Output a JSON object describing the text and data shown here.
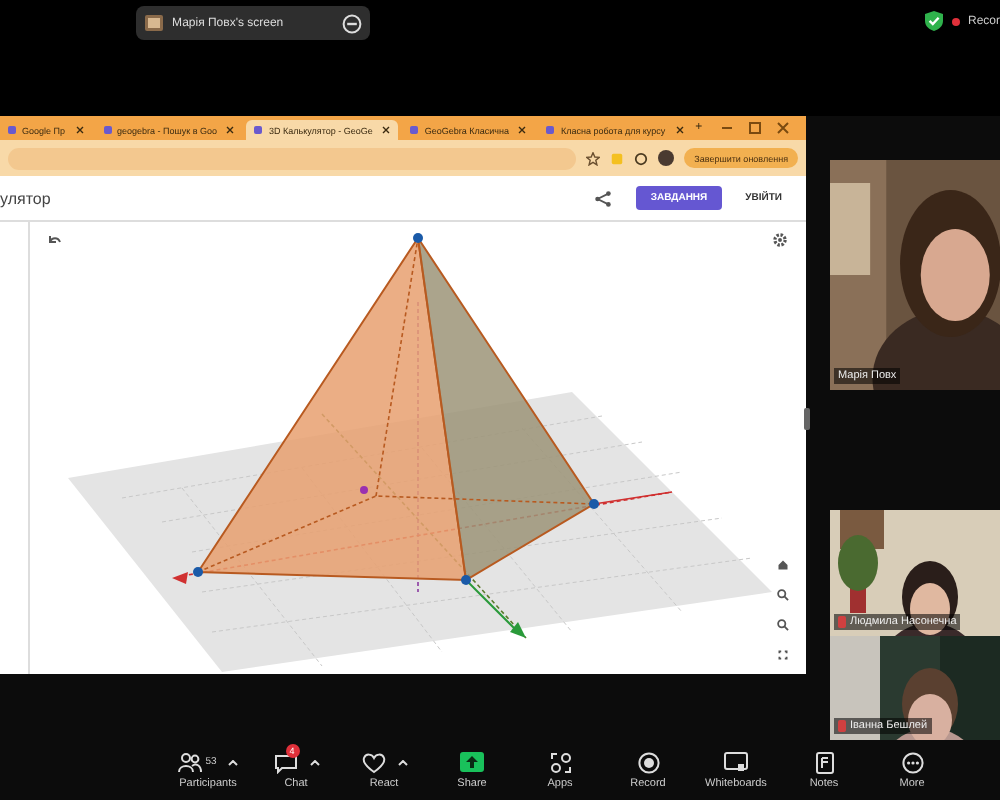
{
  "share_banner": {
    "label": "Марія Повх's screen"
  },
  "recording": {
    "label": "Recor"
  },
  "browser": {
    "tabs": [
      {
        "title": "Google Пр",
        "selected": false
      },
      {
        "title": "geogebra - Пошук в Goo",
        "selected": false
      },
      {
        "title": "3D Калькулятор - GeoGe",
        "selected": true
      },
      {
        "title": "GeoGebra Класична",
        "selected": false
      },
      {
        "title": "Класна робота для курсу",
        "selected": false
      }
    ],
    "new_tab": "+",
    "update_button": "Завершити оновлення"
  },
  "app": {
    "title": "улятор",
    "task_button": "ЗАВДАННЯ",
    "login_button": "УВІЙТИ"
  },
  "videos": [
    {
      "name": "Марія Повх"
    },
    {
      "name": "Людмила Насонечна"
    },
    {
      "name": "Іванна Бешлей"
    }
  ],
  "toolbar": [
    {
      "kind": "participants",
      "label": "Participants",
      "count": "53"
    },
    {
      "kind": "chat",
      "label": "Chat",
      "badge": "4"
    },
    {
      "kind": "react",
      "label": "React"
    },
    {
      "kind": "share",
      "label": "Share"
    },
    {
      "kind": "apps",
      "label": "Apps"
    },
    {
      "kind": "record",
      "label": "Record"
    },
    {
      "kind": "whiteboards",
      "label": "Whiteboards"
    },
    {
      "kind": "notes",
      "label": "Notes"
    },
    {
      "kind": "more",
      "label": "More"
    }
  ]
}
